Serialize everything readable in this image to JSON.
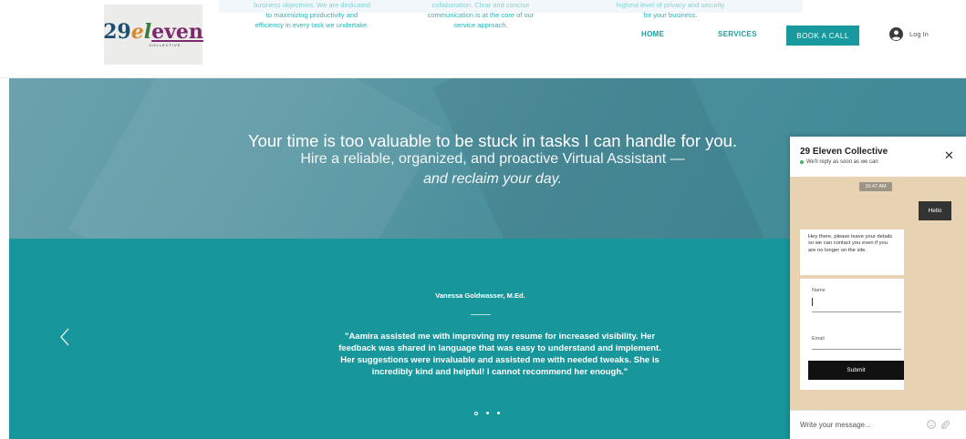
{
  "header": {
    "logo": {
      "number": "29",
      "word_part1": "e",
      "word_part2": "l",
      "word_part3": "even",
      "subtitle": "COLLECTIVE"
    },
    "intro_texts": [
      {
        "cut_line": "business objectives. We are dedicated",
        "lines": [
          "to maximizing productivity and",
          "efficiency in every task we undertake."
        ]
      },
      {
        "cut_line": "collaboration. Clear and concise",
        "lines": [
          "communication is at the core of our",
          "service approach."
        ]
      },
      {
        "cut_line": "highest level of privacy and security",
        "lines": [
          "for your business."
        ]
      }
    ],
    "nav": {
      "home": "HOME",
      "services": "SERVICES"
    },
    "book_call": "BOOK A CALL",
    "login": "Log In"
  },
  "hero": {
    "line1": "Your time is too valuable to be stuck in tasks I can handle for you.",
    "line2": "Hire a reliable, organized, and proactive Virtual Assistant —",
    "line3": "and reclaim your day."
  },
  "testimonial": {
    "author": "Vanessa Goldwasser, M.Ed.",
    "quote": "\"Aamira assisted me with improving my resume for increased visibility. Her feedback was shared in language that was easy to understand and implement. Her suggestions were invaluable and assisted me with needed tweaks. She is incredibly kind and helpful! I cannot recommend her enough.\"",
    "slide_count": 3,
    "active_slide": 1
  },
  "chat": {
    "title": "29 Eleven Collective",
    "status": "We'll reply as soon as we can",
    "time": "10:47 AM",
    "user_message": "Hello",
    "bot_message": "Hey there, please leave your details so we can contact you even if you are no longer on the site.",
    "form": {
      "name_label": "Name",
      "email_label": "Email",
      "submit": "Submit"
    },
    "input_placeholder": "Write your message..."
  },
  "colors": {
    "teal": "#17969b",
    "accent_text": "#2cb3b5",
    "chat_bg": "#e7d3b2",
    "hero_blue": "#4b8f9c"
  },
  "icons": [
    "user-circle-icon",
    "chevron-left-icon",
    "close-icon",
    "emoji-icon",
    "attachment-icon"
  ]
}
